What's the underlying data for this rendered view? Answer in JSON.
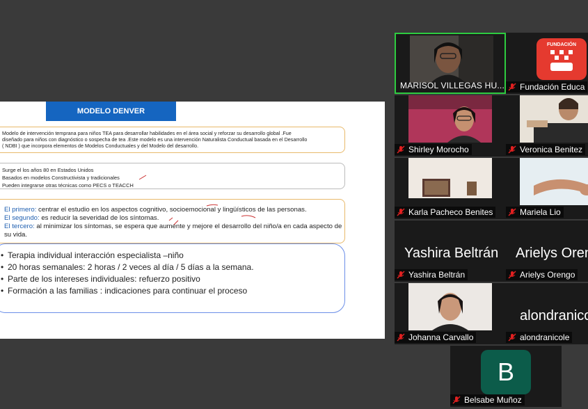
{
  "slide": {
    "title": "MODELO DENVER",
    "box1_line1": "Modelo de intervención temprana para niños TEA para desarrollar habilidades en el área social y reforzar su desarrollo global .Fue",
    "box1_line2": "diseñado para niños con  diagnóstico o sospecha de tea .Este modelo es una intervención Naturalista Conductual basada en el Desarrollo",
    "box1_line3": "( NDBI ) que incorpora elementos de Modelos Conductuales  y del Modelo del desarrollo.",
    "box2_items": [
      "Surge el los años 80 en Estados Unidos",
      "Basados en modelos Constructivista y tradicionales",
      "Pueden integrarse otras técnicas como  PECS o TEACCH"
    ],
    "box3_items": [
      {
        "label": "El primero:",
        "text": " centrar el estudio en los aspectos cognitivo, socioemocional y lingüísticos de las personas."
      },
      {
        "label": "El segundo:",
        "text": " es reducir la severidad de los síntomas."
      },
      {
        "label": "El tercero:",
        "text": " al minimizar los síntomas, se espera que aumente y mejore el desarrollo del niño/a en cada aspecto de su vida."
      }
    ],
    "box4_items": [
      "Terapia individual interacción especialista –niño",
      "20 horas semanales: 2 horas / 2 veces al día / 5 días a la semana.",
      "Parte de los intereses individuales: refuerzo positivo",
      "Formación a las familias : indicaciones para continuar el proceso"
    ]
  },
  "participants": {
    "p1": {
      "name": "MARISOL VILLEGAS HU...",
      "muted": false,
      "active": true
    },
    "p2": {
      "name": "Fundación Educa",
      "muted": true,
      "logo_text": "FUNDACIÓN"
    },
    "p3": {
      "name": "Shirley Morocho",
      "muted": true
    },
    "p4": {
      "name": "Veronica Benitez",
      "muted": true
    },
    "p5": {
      "name": "Karla Pacheco Benites",
      "muted": true
    },
    "p6": {
      "name": "Mariela Lio",
      "muted": true
    },
    "p7": {
      "name": "Yashira Beltrán",
      "display": "Yashira Beltrán",
      "muted": true
    },
    "p8": {
      "name": "Arielys Orengo",
      "display": "Arielys Oren",
      "muted": true
    },
    "p9": {
      "name": "Johanna Carvallo",
      "muted": true
    },
    "p10": {
      "name": "alondranicole",
      "display": "alondranicol",
      "muted": true
    },
    "p11": {
      "name": "Belsabe Muñoz",
      "avatar_letter": "B",
      "muted": true
    }
  },
  "colors": {
    "active_border": "#2ecc40",
    "mute_red": "#e02020",
    "slide_title_bg": "#1565c0"
  }
}
